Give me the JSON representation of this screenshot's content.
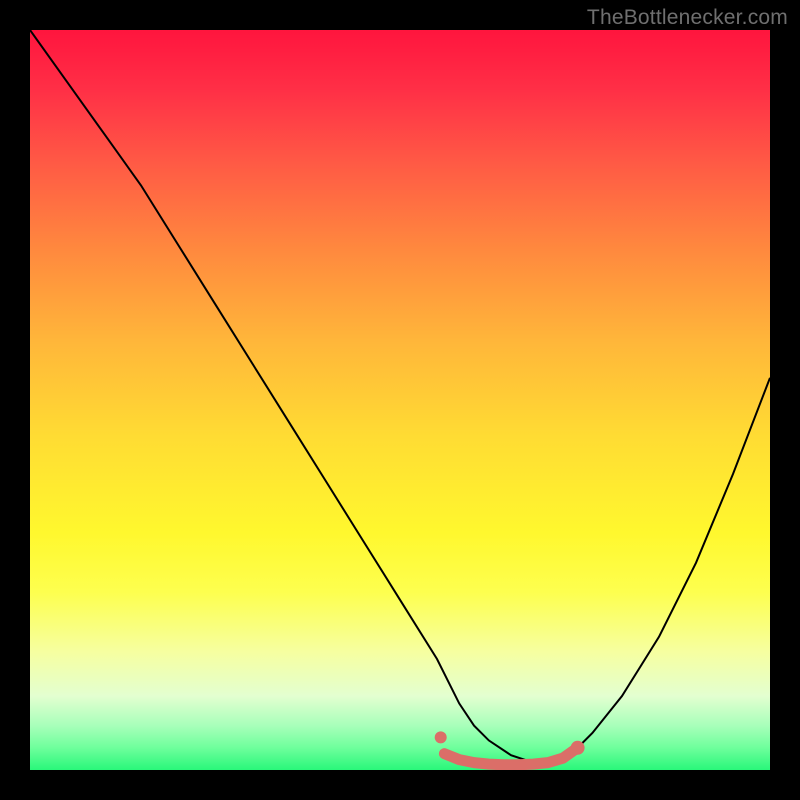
{
  "attribution": "TheBottlenecker.com",
  "chart_data": {
    "type": "line",
    "title": "",
    "xlabel": "",
    "ylabel": "",
    "xlim": [
      0,
      100
    ],
    "ylim": [
      0,
      100
    ],
    "series": [
      {
        "name": "bottleneck-curve",
        "x": [
          0,
          5,
          10,
          15,
          20,
          25,
          30,
          35,
          40,
          45,
          50,
          55,
          58,
          60,
          62,
          65,
          68,
          70,
          73,
          76,
          80,
          85,
          90,
          95,
          100
        ],
        "values": [
          100,
          93,
          86,
          79,
          71,
          63,
          55,
          47,
          39,
          31,
          23,
          15,
          9,
          6,
          4,
          2,
          1,
          1,
          2,
          5,
          10,
          18,
          28,
          40,
          53
        ]
      },
      {
        "name": "bottom-marker",
        "x": [
          56,
          58,
          60,
          62,
          64,
          66,
          68,
          70,
          72,
          74
        ],
        "values": [
          2.2,
          1.4,
          1.0,
          0.8,
          0.7,
          0.7,
          0.8,
          1.0,
          1.6,
          3.0
        ]
      }
    ],
    "colors": {
      "curve": "#000000",
      "marker": "#db6e68"
    }
  }
}
